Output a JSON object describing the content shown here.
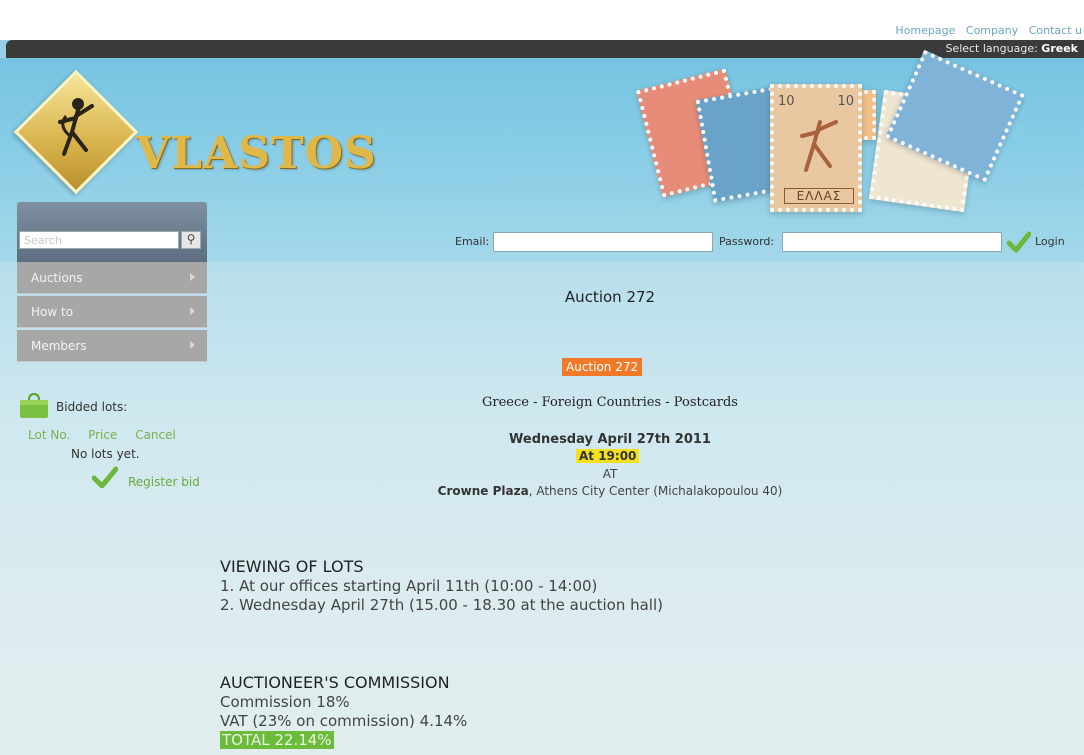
{
  "top_nav": [
    "Homepage",
    "Company",
    "Contact u"
  ],
  "language_bar": {
    "label": "Select language:",
    "value": "Greek"
  },
  "brand": {
    "name": "VLASTOS",
    "logo_icon": "hermes-figure-icon"
  },
  "stamps": {
    "country": "ΕΛΛΑΣ",
    "denomination": "10"
  },
  "search": {
    "placeholder": "Search",
    "icon": "magnifier-icon"
  },
  "sidebar_menu": [
    {
      "label": "Auctions"
    },
    {
      "label": "How to"
    },
    {
      "label": "Members"
    }
  ],
  "login": {
    "email_label": "Email:",
    "password_label": "Password:",
    "login_label": "Login",
    "icon": "green-check-icon"
  },
  "bidded": {
    "title": "Bidded lots:",
    "columns": [
      "Lot No.",
      "Price",
      "Cancel"
    ],
    "empty": "No lots yet.",
    "register": "Register bid",
    "icon": "shopping-bag-icon"
  },
  "main": {
    "page_title": "Auction 272",
    "badge": "Auction 272",
    "subtitle": "Greece - Foreign Countries - Postcards",
    "date": "Wednesday April 27th 2011",
    "time": "At 19:00",
    "at": "AT",
    "venue_name": "Crowne Plaza",
    "venue_detail": ", Athens City Center (Michalakopoulou 40)",
    "viewing_title": "VIEWING OF LOTS",
    "viewing_lines": [
      "1. At our offices starting April 11th (10:00 - 14:00)",
      "2. Wednesday April 27th (15.00 - 18.30 at the auction hall)"
    ],
    "commission_title": "AUCTIONEER'S COMMISSION",
    "commission_lines": [
      "Commission 18%",
      "VAT (23% on commission) 4.14%"
    ],
    "total": "TOTAL 22.14%"
  },
  "colors": {
    "header_blue": "#8fd0e7",
    "dark_bar": "#3b3b3b",
    "auction_badge": "#f07a2a",
    "time_badge": "#f4e01c",
    "total_highlight": "#6dbb3a",
    "link_green": "#6aa840",
    "nav_link": "#6aa7c9"
  }
}
